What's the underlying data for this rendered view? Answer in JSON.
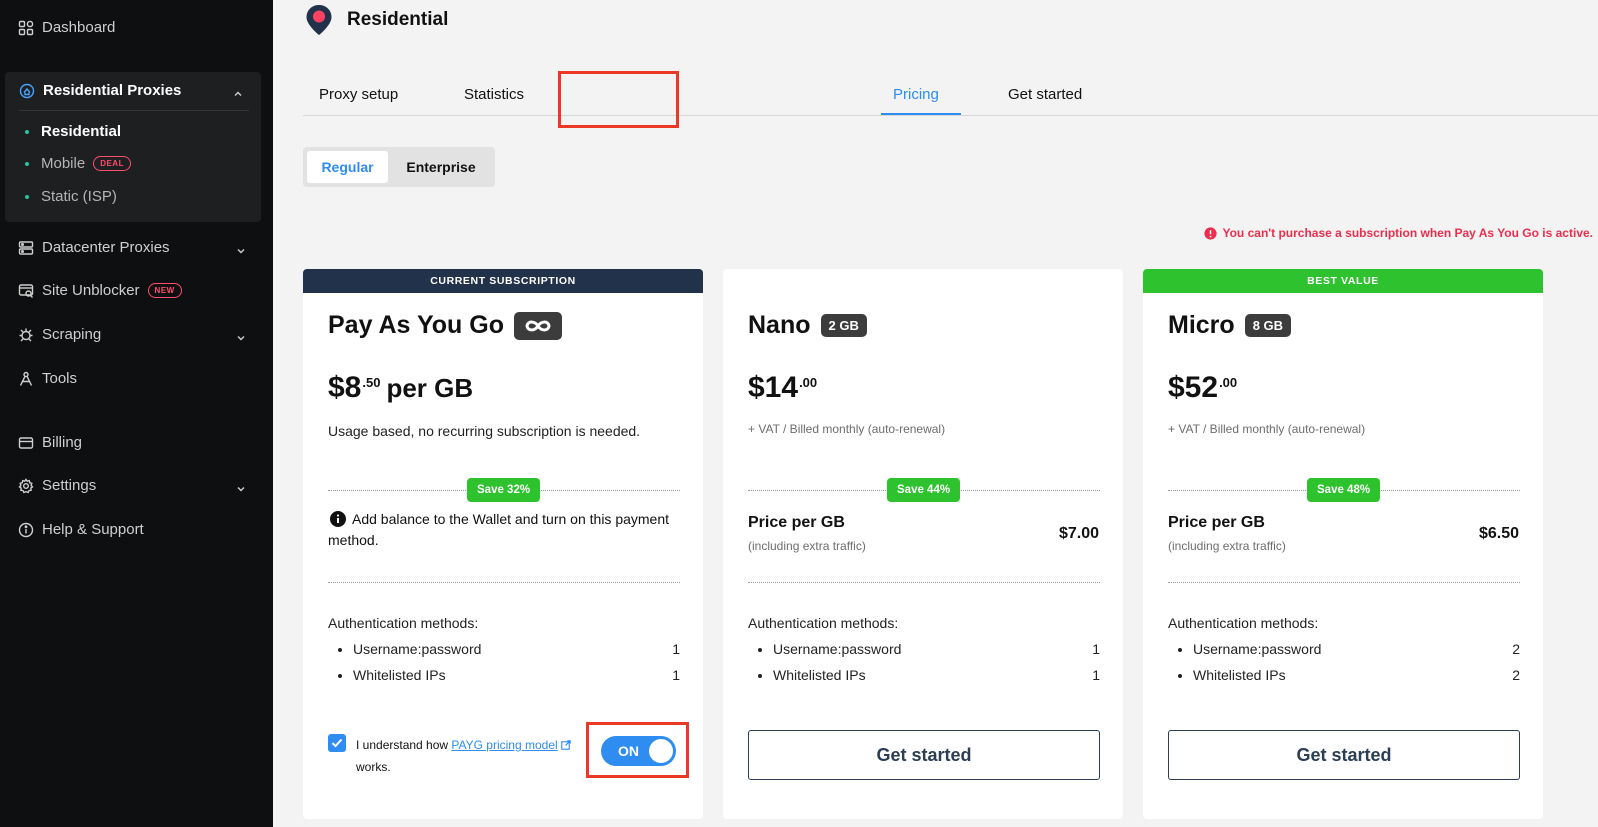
{
  "sidebar": {
    "dashboard": "Dashboard",
    "residential_proxies": "Residential Proxies",
    "sub_items": [
      {
        "label": "Residential"
      },
      {
        "label": "Mobile",
        "badge": "DEAL"
      },
      {
        "label": "Static (ISP)"
      }
    ],
    "datacenter": "Datacenter Proxies",
    "site_unblocker": "Site Unblocker",
    "site_unblocker_badge": "NEW",
    "scraping": "Scraping",
    "tools": "Tools",
    "billing": "Billing",
    "settings": "Settings",
    "help": "Help & Support"
  },
  "header": {
    "title": "Residential"
  },
  "tabs": [
    {
      "label": "Proxy setup"
    },
    {
      "label": "Statistics"
    },
    {
      "label": "Pricing",
      "active": true
    },
    {
      "label": "Get started"
    }
  ],
  "segment": {
    "regular": "Regular",
    "enterprise": "Enterprise",
    "selected": "Regular"
  },
  "warning": "You can't purchase a subscription when Pay As You Go is active.",
  "plans": [
    {
      "banner": "CURRENT SUBSCRIPTION",
      "banner_color": "#22324a",
      "name": "Pay As You Go",
      "price_main": "$8",
      "price_cents": ".50",
      "price_per": "per GB",
      "sub": "Usage based, no recurring subscription is needed.",
      "save": "Save 32%",
      "info": "Add balance to the Wallet and turn on this payment method.",
      "auth_title": "Authentication methods:",
      "auth": [
        {
          "name": "Username:password",
          "value": "1"
        },
        {
          "name": "Whitelisted IPs",
          "value": "1"
        }
      ],
      "understand_pre": "I understand how",
      "understand_link": "PAYG pricing model",
      "understand_post": "works.",
      "checked": true,
      "toggle": "ON"
    },
    {
      "name": "Nano",
      "size": "2 GB",
      "price_main": "$14",
      "price_cents": ".00",
      "sub": "+ VAT / Billed monthly (auto-renewal)",
      "save": "Save 44%",
      "ppg_label": "Price per GB",
      "ppg_sub": "(including extra traffic)",
      "ppg_value": "$7.00",
      "auth_title": "Authentication methods:",
      "auth": [
        {
          "name": "Username:password",
          "value": "1"
        },
        {
          "name": "Whitelisted IPs",
          "value": "1"
        }
      ],
      "cta": "Get started"
    },
    {
      "banner": "BEST VALUE",
      "banner_color": "#2ec22f",
      "name": "Micro",
      "size": "8 GB",
      "price_main": "$52",
      "price_cents": ".00",
      "sub": "+ VAT / Billed monthly (auto-renewal)",
      "save": "Save 48%",
      "ppg_label": "Price per GB",
      "ppg_sub": "(including extra traffic)",
      "ppg_value": "$6.50",
      "auth_title": "Authentication methods:",
      "auth": [
        {
          "name": "Username:password",
          "value": "2"
        },
        {
          "name": "Whitelisted IPs",
          "value": "2"
        }
      ],
      "cta": "Get started"
    }
  ],
  "colors": {
    "accent": "#2f8cf1",
    "save_green": "#2ec22f",
    "warning_red": "#ea2f4e",
    "highlight": "#ea3a26"
  }
}
